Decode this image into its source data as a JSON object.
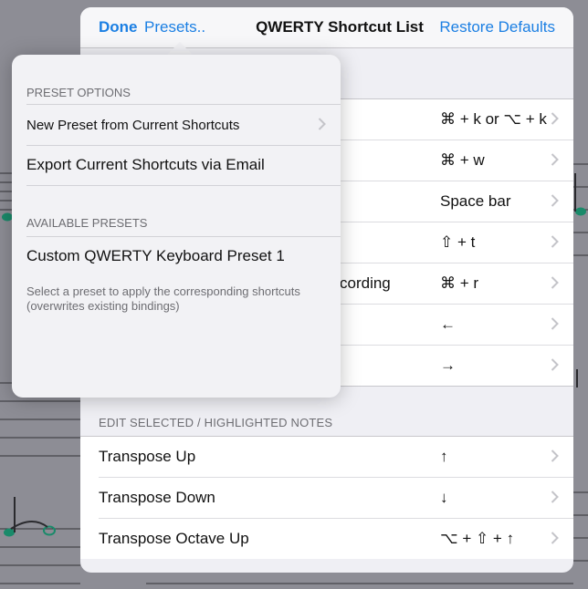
{
  "navbar": {
    "done_label": "Done",
    "presets_label": "Presets..",
    "title": "QWERTY Shortcut List",
    "restore_label": "Restore Defaults"
  },
  "shortcuts_top": [
    {
      "label": "",
      "shortcut": "⌘ + k or ⌥ + k"
    },
    {
      "label": "",
      "shortcut": "⌘ + w"
    },
    {
      "label": "",
      "shortcut": "Space bar"
    },
    {
      "label": "",
      "shortcut": "⇧ + t"
    },
    {
      "label": "cording",
      "shortcut": "⌘ + r"
    },
    {
      "label": "",
      "shortcut": "←"
    },
    {
      "label": "",
      "shortcut": "→"
    }
  ],
  "edit_section": {
    "header": "EDIT SELECTED / HIGHLIGHTED NOTES",
    "rows": [
      {
        "label": "Transpose Up",
        "shortcut": "↑"
      },
      {
        "label": "Transpose Down",
        "shortcut": "↓"
      },
      {
        "label": "Transpose Octave Up",
        "shortcut": "⌥ + ⇧ + ↑"
      }
    ]
  },
  "popover": {
    "preset_options_header": "PRESET OPTIONS",
    "new_preset_label": "New Preset from Current Shortcuts",
    "export_label": "Export Current Shortcuts via Email",
    "available_header": "AVAILABLE PRESETS",
    "preset_item_label": "Custom QWERTY Keyboard Preset 1",
    "footer": "Select a preset to apply the corresponding shortcuts (overwrites existing bindings)"
  },
  "colors": {
    "accent": "#1b7fe3",
    "note_green": "#1a8a6a",
    "background_dim": "#8d8d95"
  }
}
